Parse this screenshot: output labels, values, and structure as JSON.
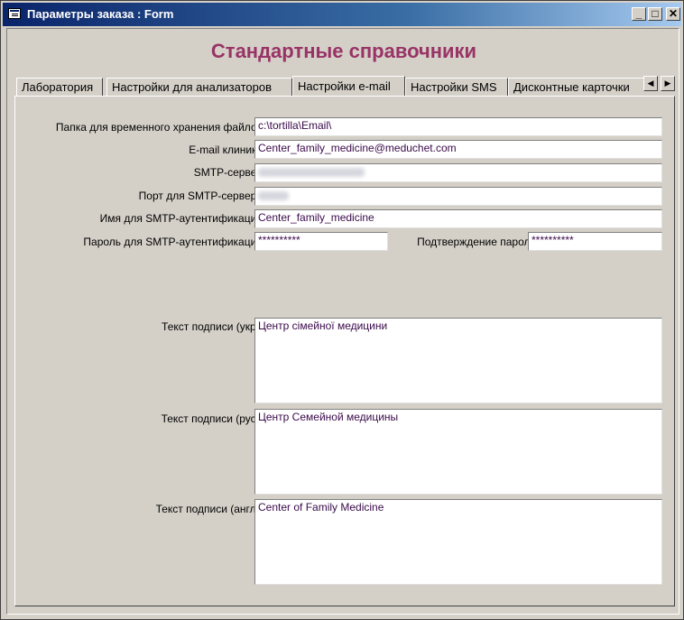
{
  "window": {
    "title": "Параметры заказа : Form"
  },
  "controls": {
    "minimize": "_",
    "maximize": "□",
    "close": "✕"
  },
  "heading": "Стандартные справочники",
  "tabs": [
    {
      "label": "Лаборатория"
    },
    {
      "label": "Настройки для анализаторов"
    },
    {
      "label": "Настройки e-mail"
    },
    {
      "label": "Настройки SMS"
    },
    {
      "label": "Дисконтные карточки"
    }
  ],
  "tab_scroll": {
    "left": "◀",
    "right": "▶"
  },
  "fields": {
    "temp_folder": {
      "label": "Папка для временного хранения файлов",
      "value": "c:\\tortilla\\Email\\"
    },
    "clinic_email": {
      "label": "E-mail клиники",
      "value": "Center_family_medicine@meduchet.com"
    },
    "smtp_server": {
      "label": "SMTP-сервер"
    },
    "smtp_port": {
      "label": "Порт для SMTP-сервера"
    },
    "smtp_user": {
      "label": "Имя для SMTP-аутентификации",
      "value": "Center_family_medicine"
    },
    "smtp_password": {
      "label": "Пароль для SMTP-аутентификации",
      "value": "**********"
    },
    "password_confirm": {
      "label": "Подтверждение пароля",
      "value": "**********"
    },
    "signature_ukr": {
      "label": "Текст подписи (укр.)",
      "value": "Центр сімейної медицини"
    },
    "signature_rus": {
      "label": "Текст подписи (рус.)",
      "value": "Центр Семейной медицины"
    },
    "signature_eng": {
      "label": "Текст подписи (англ.)",
      "value": "Center of Family Medicine"
    }
  }
}
